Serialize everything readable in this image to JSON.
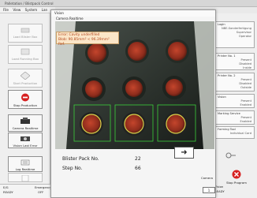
{
  "app": {
    "title": "Palletation / Blistpack Control",
    "menu": [
      "File",
      "View",
      "System",
      "Lan"
    ]
  },
  "left_panel": {
    "buttons": [
      {
        "label": "Load Blister Box",
        "icon": "tray-icon"
      },
      {
        "label": "Load Running Box",
        "icon": "box-icon"
      },
      {
        "label": "Start Production",
        "icon": "start-icon"
      },
      {
        "label": "Stop Production",
        "icon": "stop-icon"
      },
      {
        "label": "Camera Realtime",
        "icon": "camera-icon"
      },
      {
        "label": "Vision Last Error",
        "icon": "vision-icon"
      },
      {
        "label": "Log Realtime",
        "icon": "log-icon"
      },
      {
        "label": "",
        "icon": "document-icon"
      }
    ],
    "status": {
      "left_top": "E/G",
      "left_bottom": "READY",
      "right_top": "Emergency",
      "right_bottom": "OFF"
    }
  },
  "right_panel": {
    "login": {
      "title": "Login",
      "lines": [
        "NBE-Sonderfertigung",
        "Supervisor",
        "Operator"
      ]
    },
    "boxes": [
      {
        "title": "Printer No. 1",
        "lines": [
          "Present",
          "Disabled",
          "Inside"
        ]
      },
      {
        "title": "Printer No. 2",
        "lines": [
          "Present",
          "Disabled",
          "Outside"
        ]
      },
      {
        "title": "Vision",
        "lines": [
          "Present",
          "Enabled"
        ]
      },
      {
        "title": "Marking Service",
        "lines": [
          "Present",
          "Enabled"
        ]
      },
      {
        "title": "Forming Tool",
        "lines": [
          "Individual Card"
        ]
      }
    ],
    "stop_program_label": "Stop Program",
    "status": {
      "top": "Vision",
      "bottom": "READY"
    }
  },
  "vision_window": {
    "title": "Vision",
    "tab_label": "Camera Realtime",
    "error": {
      "line1": "Error: Cavity underfilled",
      "line2": "Blob: 90.85mm² < 96.39mm² Ref."
    },
    "blister_pack_label": "Blister Pack No.",
    "blister_pack_no": "22",
    "step_label": "Step No.",
    "step_no": "66",
    "arrow_label": "➜",
    "camera_label": "Camera",
    "camera_value": "1"
  },
  "colors": {
    "error_text": "#b4481e",
    "error_bg": "#fbe6c8",
    "detection_box": "#3bcf3b",
    "stop_red": "#d62020"
  }
}
